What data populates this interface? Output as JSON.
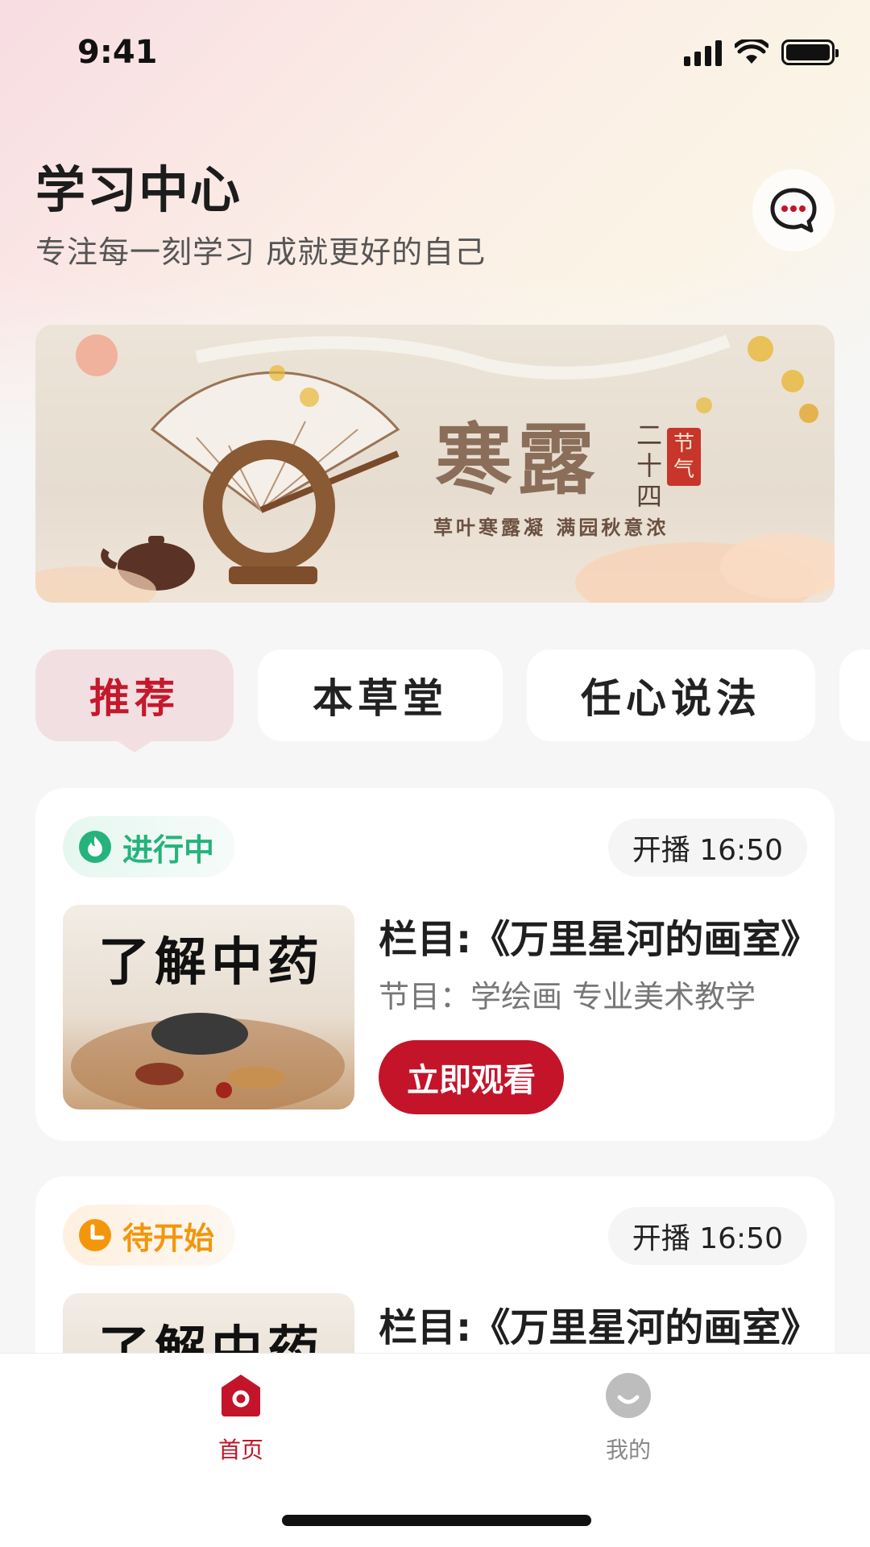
{
  "status_bar": {
    "time": "9:41"
  },
  "header": {
    "title": "学习中心",
    "subtitle": "专注每一刻学习 成就更好的自己",
    "message_icon": "chat-bubble-icon"
  },
  "banner": {
    "title": "寒露",
    "vertical_text": "二十四",
    "seal_text": "节气",
    "caption": "草叶寒露凝  满园秋意浓"
  },
  "tabs": [
    {
      "label": "推荐",
      "active": true
    },
    {
      "label": "本草堂",
      "active": false
    },
    {
      "label": "任心说法",
      "active": false
    }
  ],
  "cards": [
    {
      "status": "进行中",
      "status_icon": "flame-icon",
      "time": "开播 16:50",
      "thumb_text": "了解中药",
      "column_title": "栏目:《万里星河的画室》",
      "program": "节目：学绘画 专业美术教学",
      "button": "立即观看"
    },
    {
      "status": "待开始",
      "status_icon": "clock-icon",
      "time": "开播 16:50",
      "thumb_text": "了解中药",
      "column_title": "栏目:《万里星河的画室》"
    }
  ],
  "bottom_nav": [
    {
      "label": "首页",
      "icon": "home-icon",
      "active": true
    },
    {
      "label": "我的",
      "icon": "profile-icon",
      "active": false
    }
  ],
  "colors": {
    "accent": "#c3142a",
    "live": "#25b37c",
    "waiting": "#f3960b"
  }
}
